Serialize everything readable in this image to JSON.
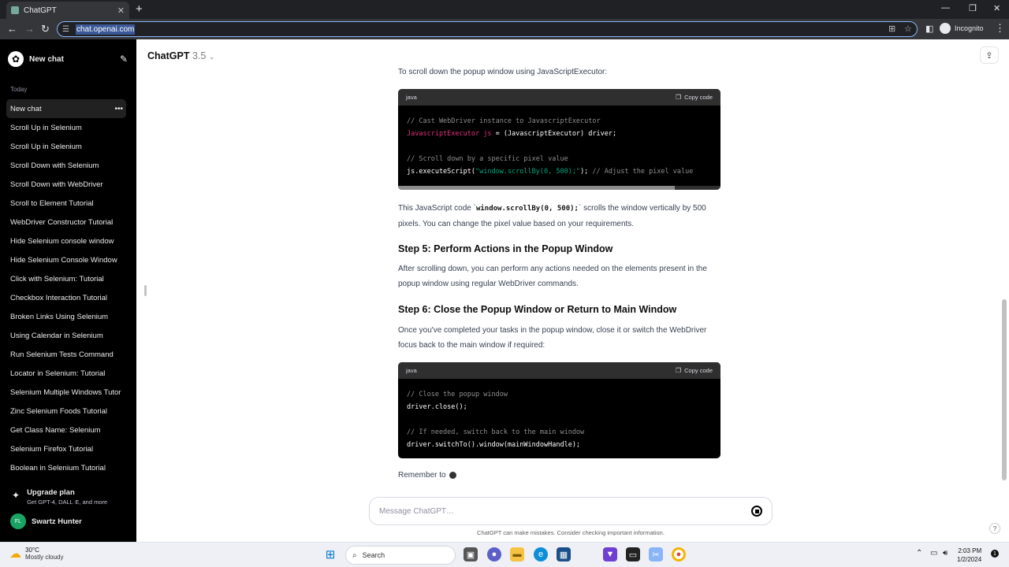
{
  "browser": {
    "tab_title": "ChatGPT",
    "url": "chat.openai.com",
    "incognito_label": "Incognito"
  },
  "sidebar": {
    "new_chat_label": "New chat",
    "section_today": "Today",
    "items": [
      {
        "label": "New chat"
      },
      {
        "label": "Scroll Up in Selenium"
      },
      {
        "label": "Scroll Up in Selenium"
      },
      {
        "label": "Scroll Down with Selenium"
      },
      {
        "label": "Scroll Down with WebDriver"
      },
      {
        "label": "Scroll to Element Tutorial"
      },
      {
        "label": "WebDriver Constructor Tutorial"
      },
      {
        "label": "Hide Selenium console window"
      },
      {
        "label": "Hide Selenium Console Window"
      },
      {
        "label": "Click with Selenium: Tutorial"
      },
      {
        "label": "Checkbox Interaction Tutorial"
      },
      {
        "label": "Broken Links Using Selenium"
      },
      {
        "label": "Using Calendar in Selenium"
      },
      {
        "label": "Run Selenium Tests Command"
      },
      {
        "label": "Locator in Selenium: Tutorial"
      },
      {
        "label": "Selenium Multiple Windows Tutor"
      },
      {
        "label": "Zinc Selenium Foods Tutorial"
      },
      {
        "label": "Get Class Name: Selenium"
      },
      {
        "label": "Selenium Firefox Tutorial"
      },
      {
        "label": "Boolean in Selenium Tutorial"
      }
    ],
    "upgrade_title": "Upgrade plan",
    "upgrade_sub": "Get GPT-4, DALL·E, and more",
    "user_initials": "FL",
    "user_name": "Swartz Hunter"
  },
  "header": {
    "model_name": "ChatGPT",
    "model_version": "3.5"
  },
  "content": {
    "intro": "To scroll down the popup window using JavaScriptExecutor:",
    "code1": {
      "lang": "java",
      "copy_label": "Copy code",
      "line1": "// Cast WebDriver instance to JavascriptExecutor",
      "line2_type": "JavascriptExecutor js",
      "line2_rest": " = (JavascriptExecutor) driver;",
      "line3": "// Scroll down by a specific pixel value",
      "line4_a": "js.executeScript(",
      "line4_str": "\"window.scrollBy(0, 500);\"",
      "line4_b": "); ",
      "line4_cm": "// Adjust the pixel value"
    },
    "para1_a": "This JavaScript code `",
    "para1_code": "window.scrollBy(0, 500);",
    "para1_b": "` scrolls the window vertically by 500 pixels. You can change the pixel value based on your requirements.",
    "step5_title": "Step 5: Perform Actions in the Popup Window",
    "step5_text": "After scrolling down, you can perform any actions needed on the elements present in the popup window using regular WebDriver commands.",
    "step6_title": "Step 6: Close the Popup Window or Return to Main Window",
    "step6_text": "Once you've completed your tasks in the popup window, close it or switch the WebDriver focus back to the main window if required:",
    "code2": {
      "lang": "java",
      "copy_label": "Copy code",
      "line1": "// Close the popup window",
      "line2": "driver.close();",
      "line3": "// If needed, switch back to the main window",
      "line4": "driver.switchTo().window(mainWindowHandle);"
    },
    "remember": "Remember to"
  },
  "composer": {
    "placeholder": "Message ChatGPT…",
    "disclaimer": "ChatGPT can make mistakes. Consider checking important information."
  },
  "taskbar": {
    "temp": "30°C",
    "weather": "Mostly cloudy",
    "search_label": "Search",
    "time": "2:03 PM",
    "date": "1/2/2024",
    "notif_count": "1"
  }
}
